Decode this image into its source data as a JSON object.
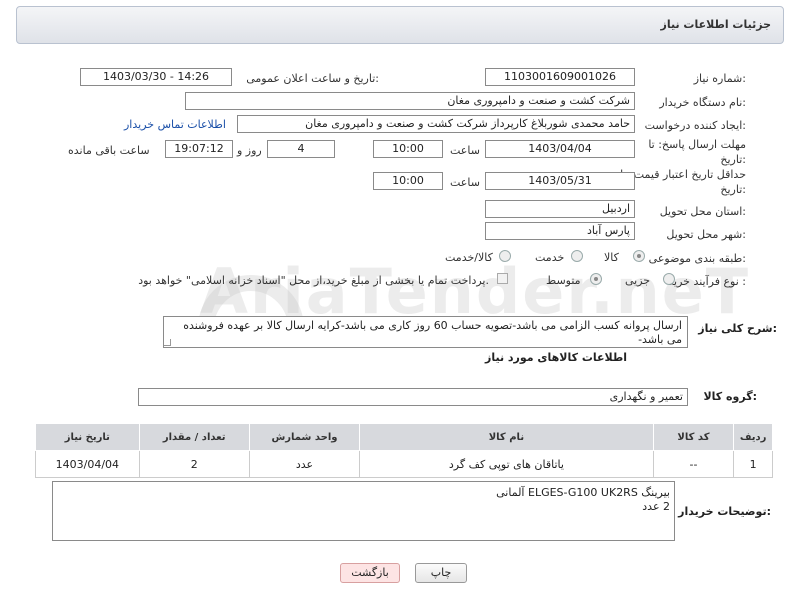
{
  "header": {
    "title": "جزئیات اطلاعات نیاز"
  },
  "watermark": "AriaTender.neT",
  "fields": {
    "need_number_label": "شماره نیاز:",
    "need_number": "1103001609001026",
    "announce_label": "تاریخ و ساعت اعلان عمومی:",
    "announce_value": "1403/03/30 - 14:26",
    "buyer_org_label": "نام دستگاه خریدار:",
    "buyer_org": "شرکت کشت و صنعت و دامپروری مغان",
    "requester_label": "ایجاد کننده درخواست:",
    "requester": "حامد محمدی شوربلاغ کارپرداز شرکت کشت و صنعت و دامپروری مغان",
    "contact_link": "اطلاعات تماس خریدار",
    "deadline_label": "مهلت ارسال پاسخ: تا تاریخ:",
    "deadline_date": "1403/04/04",
    "time_label": "ساعت",
    "deadline_time": "10:00",
    "days_count": "4",
    "days_label": "روز و",
    "remaining_time": "19:07:12",
    "remaining_label": "ساعت باقی مانده",
    "price_validity_label": "حداقل تاریخ اعتبار قیمت: تا تاریخ:",
    "price_validity_date": "1403/05/31",
    "price_validity_time": "10:00",
    "province_label": "استان محل تحویل:",
    "province": "اردبیل",
    "city_label": "شهر محل تحویل:",
    "city": "پارس آباد",
    "category_label": "طبقه بندی موضوعی:",
    "category_options": [
      "کالا",
      "خدمت",
      "کالا/خدمت"
    ],
    "purchase_type_label": "نوع فرآیند خرید :",
    "purchase_options": [
      "جزیی",
      "متوسط"
    ],
    "payment_note": "پرداخت تمام یا بخشی از مبلغ خرید،از محل \"اسناد خزانه اسلامی\" خواهد بود."
  },
  "description": {
    "label": "شرح کلی نیاز:",
    "text": "ارسال پروانه کسب الزامی می باشد-تصویه حساب 60 روز کاری می باشد-کرایه ارسال کالا بر عهده فروشنده می باشد-"
  },
  "goods": {
    "section_title": "اطلاعات کالاهای مورد نیاز",
    "group_label": "گروه کالا:",
    "group_value": "تعمیر و نگهداری",
    "columns": [
      "ردیف",
      "کد کالا",
      "نام کالا",
      "واحد شمارش",
      "تعداد / مقدار",
      "تاریخ نیاز"
    ],
    "rows": [
      {
        "row": "1",
        "code": "--",
        "name": "یاتاقان های توپی کف گرد",
        "unit": "عدد",
        "qty": "2",
        "date": "1403/04/04"
      }
    ]
  },
  "buyer_notes": {
    "label": "توضیحات خریدار:",
    "line1": "بیرینگ  ELGES-G100  UK2RS   آلمانی",
    "line2": "2 عدد"
  },
  "buttons": {
    "print": "چاپ",
    "back": "بازگشت"
  }
}
